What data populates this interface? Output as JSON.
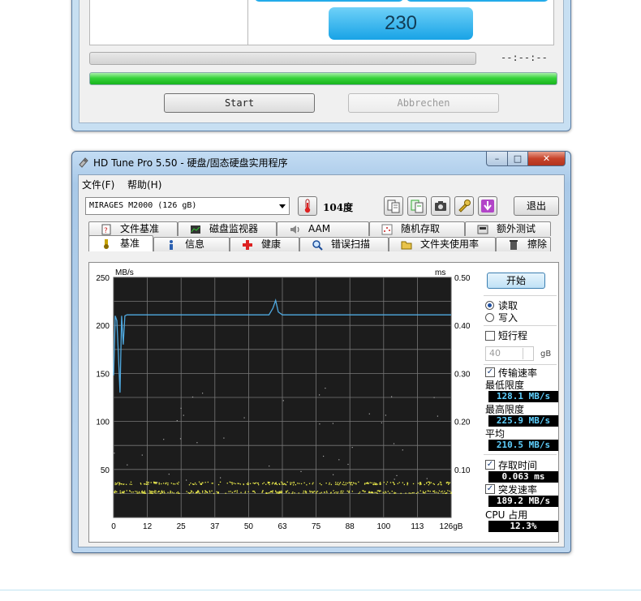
{
  "top_window": {
    "big_value": "230",
    "time_readout": "--:--:--",
    "progress_green_fraction": 1.0,
    "start_label": "Start",
    "cancel_label": "Abbrechen"
  },
  "window": {
    "title": "HD Tune Pro 5.50 - 硬盘/固态硬盘实用程序",
    "controls": {
      "minimize": "–",
      "maximize": "□",
      "close": "✕"
    },
    "menu": {
      "file": "文件(F)",
      "help": "帮助(H)"
    },
    "drive": "MIRAGES M2000  (126 gB)",
    "temperature": "104度",
    "exit_label": "退出",
    "tabs_row1": [
      "文件基准",
      "磁盘监视器",
      "AAM",
      "随机存取",
      "额外测试"
    ],
    "tabs_row2": [
      "基准",
      "信息",
      "健康",
      "错误扫描",
      "文件夹使用率",
      "擦除"
    ],
    "active_tab": "基准"
  },
  "sidebar": {
    "start_label": "开始",
    "read_label": "读取",
    "write_label": "写入",
    "short_stroke_label": "短行程",
    "short_stroke_value": "40",
    "short_stroke_unit": "gB",
    "transfer_rate_label": "传输速率",
    "min_label": "最低限度",
    "min_value": "128.1 MB/s",
    "max_label": "最高限度",
    "max_value": "225.9 MB/s",
    "avg_label": "平均",
    "avg_value": "210.5 MB/s",
    "access_time_label": "存取时间",
    "access_time_value": "0.063 ms",
    "burst_label": "突发速率",
    "burst_value": "189.2 MB/s",
    "cpu_label": "CPU 占用",
    "cpu_value": "12.3%"
  },
  "chart_data": {
    "type": "line",
    "left_unit": "MB/s",
    "right_unit": "ms",
    "x_ticks": [
      "0",
      "12",
      "25",
      "37",
      "50",
      "63",
      "75",
      "88",
      "100",
      "113",
      "126gB"
    ],
    "y_left_ticks": [
      "250",
      "200",
      "150",
      "100",
      "50"
    ],
    "y_right_ticks": [
      "0.50",
      "0.40",
      "0.30",
      "0.20",
      "0.10"
    ],
    "xlim": [
      0,
      126
    ],
    "ylim_left": [
      0,
      250
    ],
    "ylim_right": [
      0,
      0.5
    ],
    "grid": true,
    "series": [
      {
        "name": "transfer",
        "color": "#4fa9e0",
        "x": [
          0,
          0.6,
          1.2,
          1.8,
          2.4,
          3.0,
          3.6,
          4.2,
          5,
          8,
          12,
          20,
          30,
          40,
          50,
          58,
          59.5,
          60.5,
          61.5,
          63,
          70,
          80,
          90,
          100,
          110,
          120,
          126
        ],
        "y": [
          148,
          210,
          205,
          170,
          130,
          210,
          180,
          210,
          211,
          211,
          211,
          211,
          211,
          211,
          211,
          211,
          218,
          226,
          214,
          211,
          211,
          211,
          211,
          211,
          211,
          211,
          211
        ]
      },
      {
        "name": "access",
        "color": "#e8e84a",
        "band_ms": [
          0.054,
          0.072
        ]
      }
    ]
  },
  "colors": {
    "chart_bg": "#1c1c1c",
    "grid": "#7a7a7a",
    "transfer": "#4fa9e0",
    "access": "#e8e84a",
    "accent_blue": "#1ba7e8",
    "green_progress": "#1fbf25"
  }
}
